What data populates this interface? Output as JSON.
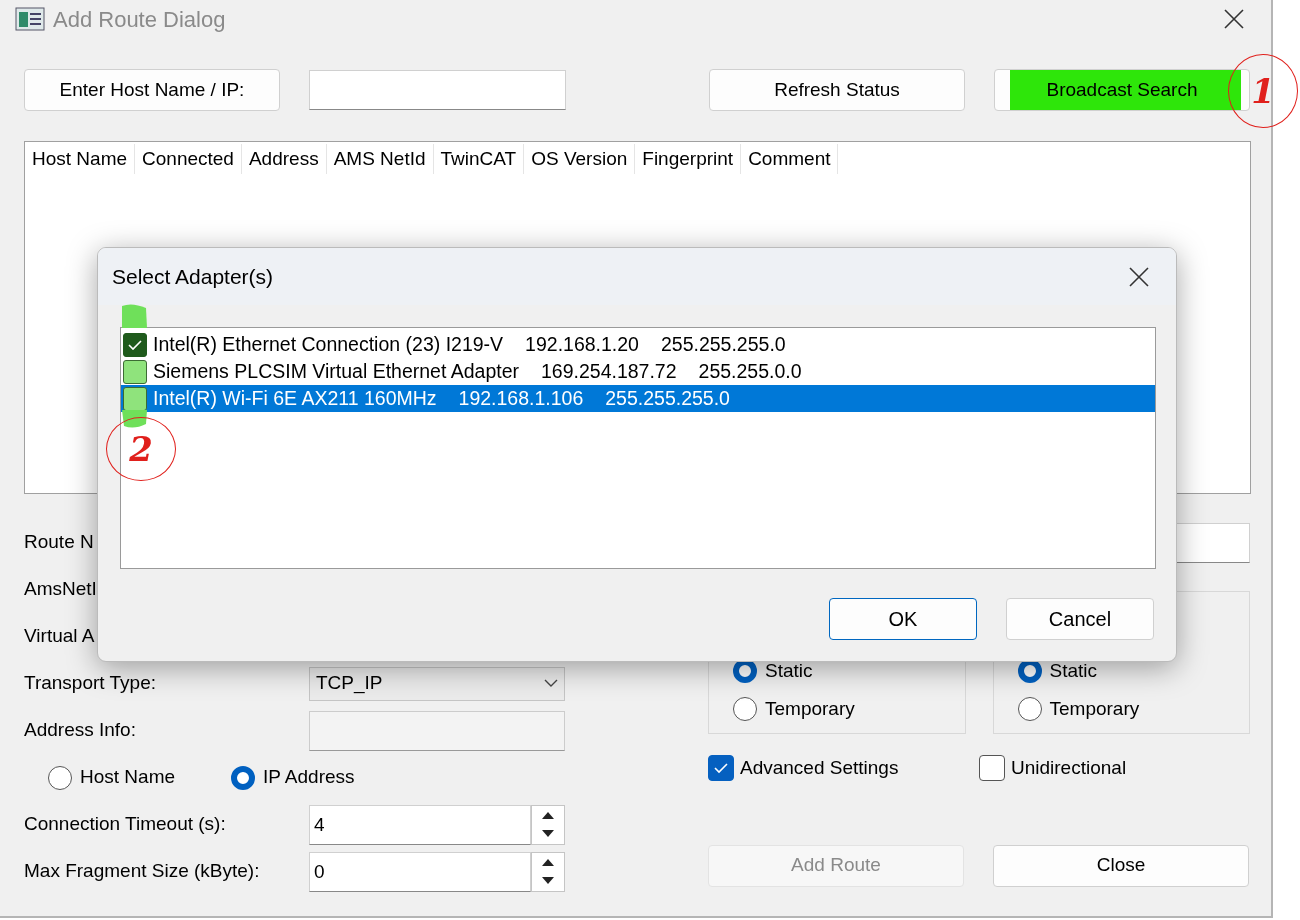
{
  "window": {
    "title": "Add Route Dialog"
  },
  "top_bar": {
    "host_button": "Enter Host Name / IP:",
    "refresh_button": "Refresh Status",
    "broadcast_button": {
      "label": "Broadcast Search",
      "highlighted": true
    }
  },
  "table": {
    "columns": [
      "Host Name",
      "Connected",
      "Address",
      "AMS NetId",
      "TwinCAT",
      "OS Version",
      "Fingerprint",
      "Comment"
    ]
  },
  "form_left": [
    {
      "kind": "label",
      "label": "Route N"
    },
    {
      "kind": "label",
      "label": "AmsNetI"
    },
    {
      "kind": "label",
      "label": "Virtual A"
    },
    {
      "kind": "select",
      "label": "Transport Type:",
      "value": "TCP_IP"
    },
    {
      "kind": "field",
      "label": "Address Info:",
      "disabled": true
    },
    {
      "kind": "radios",
      "options": [
        {
          "label": "Host Name",
          "selected": false
        },
        {
          "label": "IP Address",
          "selected": true
        }
      ]
    },
    {
      "kind": "spin",
      "label": "Connection Timeout (s):",
      "value": "4"
    },
    {
      "kind": "spin",
      "label": "Max Fragment Size (kByte):",
      "value": "0"
    }
  ],
  "route_groups": [
    {
      "options": [
        {
          "label": "Static",
          "selected": true
        },
        {
          "label": "Temporary",
          "selected": false
        }
      ]
    },
    {
      "options": [
        {
          "label": "Static",
          "selected": true
        },
        {
          "label": "Temporary",
          "selected": false
        }
      ]
    }
  ],
  "checkboxes": [
    {
      "label": "Advanced Settings",
      "checked": true
    },
    {
      "label": "Unidirectional",
      "checked": false
    }
  ],
  "buttons": [
    {
      "label": "Add Route",
      "disabled": true
    },
    {
      "label": "Close",
      "disabled": false
    }
  ],
  "modal": {
    "title": "Select Adapter(s)",
    "adapters": [
      {
        "name": "Intel(R) Ethernet Connection (23) I219-V",
        "ip": "192.168.1.20",
        "mask": "255.255.255.0",
        "checked": true,
        "selected": false
      },
      {
        "name": "Siemens PLCSIM Virtual Ethernet Adapter",
        "ip": "169.254.187.72",
        "mask": "255.255.0.0",
        "checked": false,
        "selected": false
      },
      {
        "name": "Intel(R) Wi-Fi 6E AX211 160MHz",
        "ip": "192.168.1.106",
        "mask": "255.255.255.0",
        "checked": false,
        "selected": true
      }
    ],
    "buttons": [
      {
        "label": "OK",
        "default": true
      },
      {
        "label": "Cancel",
        "default": false
      }
    ]
  },
  "annotations": [
    {
      "label": "1"
    },
    {
      "label": "2"
    }
  ]
}
